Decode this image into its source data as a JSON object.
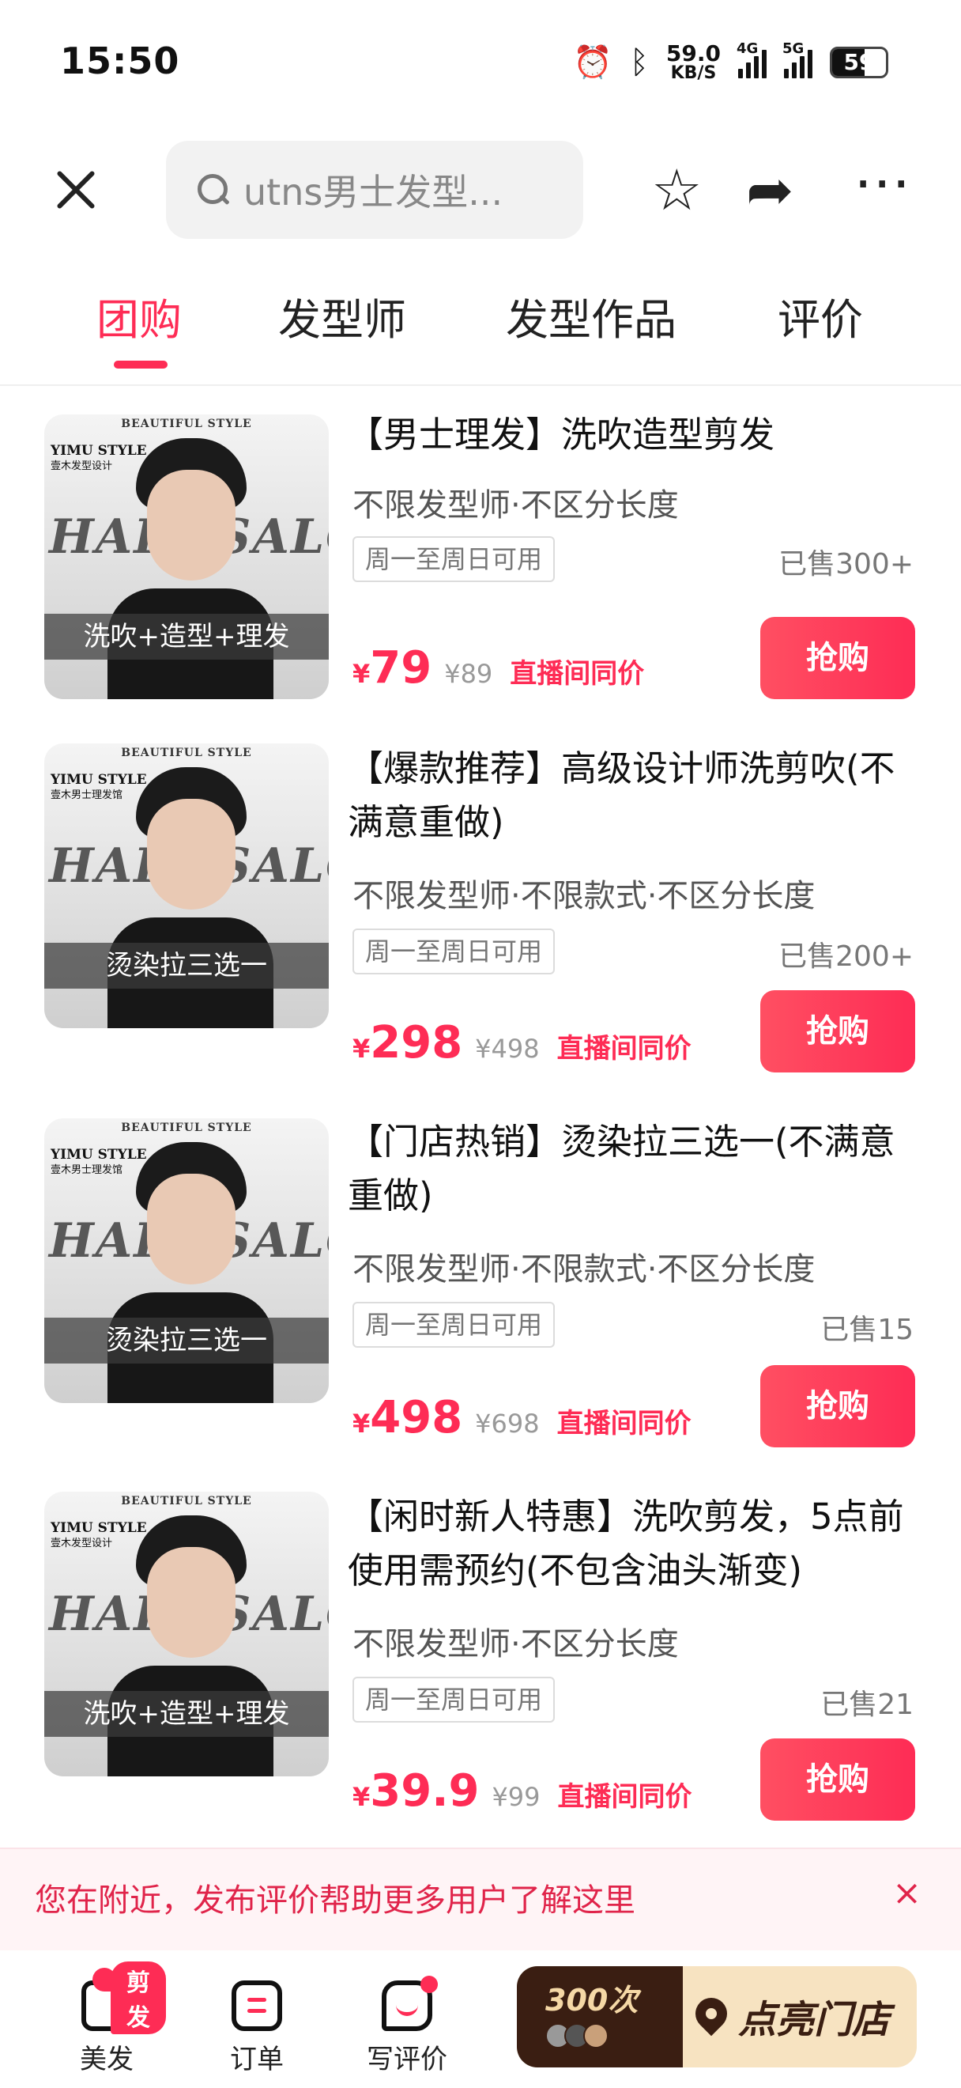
{
  "status_bar": {
    "time": "15:50",
    "net_speed": "59.0",
    "net_speed_unit": "KB/S",
    "network_4g": "4G",
    "network_5g": "5G",
    "battery": "59",
    "icons": [
      "alarm-icon",
      "bluetooth-icon",
      "signal-icon",
      "battery-icon"
    ]
  },
  "header": {
    "search_text": "utns男士发型...",
    "icons": [
      "close-icon",
      "search-icon",
      "star-icon",
      "share-icon",
      "more-icon"
    ]
  },
  "tabs": [
    {
      "label": "团购",
      "active": true
    },
    {
      "label": "发型师",
      "active": false
    },
    {
      "label": "发型作品",
      "active": false
    },
    {
      "label": "评价",
      "active": false
    }
  ],
  "thumb_common": {
    "brand_top": "BEAUTIFUL STYLE",
    "brand": "YIMU STYLE",
    "brand_sub_1": "壹木发型设计",
    "brand_sub_2": "壹木男士理发馆",
    "salon_word": "HAIR SALON"
  },
  "products": [
    {
      "thumb_band": "洗吹+造型+理发",
      "title": "【男士理发】洗吹造型剪发",
      "subtitle": "不限发型师·不区分长度",
      "tag": "周一至周日可用",
      "sold": "已售300+",
      "currency": "¥",
      "price": "79",
      "original_price": "¥89",
      "note": "直播间同价",
      "button": "抢购"
    },
    {
      "thumb_band": "烫染拉三选一",
      "title": "【爆款推荐】高级设计师洗剪吹(不满意重做)",
      "subtitle": "不限发型师·不限款式·不区分长度",
      "tag": "周一至周日可用",
      "sold": "已售200+",
      "currency": "¥",
      "price": "298",
      "original_price": "¥498",
      "note": "直播间同价",
      "button": "抢购"
    },
    {
      "thumb_band": "烫染拉三选一",
      "title": "【门店热销】烫染拉三选一(不满意重做)",
      "subtitle": "不限发型师·不限款式·不区分长度",
      "tag": "周一至周日可用",
      "sold": "已售15",
      "currency": "¥",
      "price": "498",
      "original_price": "¥698",
      "note": "直播间同价",
      "button": "抢购"
    },
    {
      "thumb_band": "洗吹+造型+理发",
      "title": "【闲时新人特惠】洗吹剪发，5点前使用需预约(不包含油头渐变)",
      "subtitle": "不限发型师·不区分长度",
      "tag": "周一至周日可用",
      "sold": "已售21",
      "currency": "¥",
      "price": "39.9",
      "original_price": "¥99",
      "note": "直播间同价",
      "button": "抢购"
    }
  ],
  "banner": {
    "text": "您在附近，发布评价帮助更多用户了解这里",
    "close": "×"
  },
  "bottom_nav": {
    "items": [
      {
        "label": "美发",
        "badge": "剪发"
      },
      {
        "label": "订单"
      },
      {
        "label": "写评价"
      }
    ],
    "promo_count": "300次",
    "promo_label": "点亮门店"
  },
  "colors": {
    "accent": "#fe2c55",
    "promo_dark": "#3a1e12",
    "promo_light": "#f7e3c1"
  }
}
